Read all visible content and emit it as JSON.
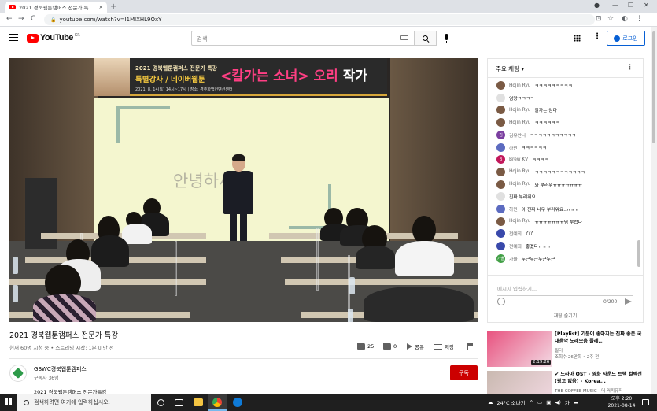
{
  "browser": {
    "tab_title": "2021 경북웹툰캠퍼스 전문가 특",
    "tab_close": "×",
    "new_tab": "+",
    "url": "youtube.com/watch?v=I1MlXHL9OxY",
    "window_controls": [
      "●",
      "—",
      "❐",
      "✕"
    ],
    "nav": [
      "←",
      "→",
      "C"
    ],
    "toolbar_icons": [
      "⊡",
      "☆",
      "◐",
      "⋮"
    ]
  },
  "youtube": {
    "logo_text": "YouTube",
    "logo_region": "KR",
    "search_placeholder": "검색",
    "login_label": "로그인"
  },
  "video": {
    "banner_line1": "2021 경북웹툰캠퍼스 전문가 특강",
    "banner_line2": "특별강사 / 네이버웹툰",
    "banner_title_part1": "<칼가는 소녀>",
    "banner_title_part2": " 오리",
    "banner_title_part3": "작가",
    "banner_info": "2021. 8. 14(토) 14시~17시 | 장소: 경주화백컨벤션센터",
    "screen_text": "안녕하세요.",
    "title": "2021 경북웹툰캠퍼스 전문가 특강",
    "meta": "현재 60명 시청 중 • 스트리밍 시작: 1분 미만 전",
    "likes": "25",
    "dislikes": "0",
    "share_label": "공유",
    "save_label": "저장"
  },
  "channel": {
    "name": "GBWC경북웹툰캠퍼스",
    "subscribers": "구독자 36명",
    "subscribe_label": "구독",
    "description": "2021 경북웹툰캠퍼스 전문가특강"
  },
  "chat": {
    "header": "주요 채팅 ▾",
    "messages": [
      {
        "author": "Hojin Ryu",
        "text": "ㅋㅋㅋㅋㅋㅋㅋㅋㅋ",
        "avatar": "",
        "color": "#7a5a44"
      },
      {
        "author": "",
        "text": "엄망ㅋㅋㅋㅋ",
        "avatar": "",
        "color": ""
      },
      {
        "author": "Hojin Ryu",
        "text": "칼가는 엄마",
        "avatar": "",
        "color": "#7a5a44"
      },
      {
        "author": "Hojin Ryu",
        "text": "ㅋㅋㅋㅋㅋㅋ",
        "avatar": "",
        "color": "#7a5a44"
      },
      {
        "author": "김유안나",
        "text": "ㅋㅋㅋㅋㅋㅋㅋㅋㅋㅋㅋ",
        "avatar": "김",
        "color": "#7b3fa0"
      },
      {
        "author": "하민",
        "text": "ㅋㅋㅋㅋㅋㅋ",
        "avatar": "",
        "color": "#5c6bc0"
      },
      {
        "author": "Brew KV",
        "text": "ㅋㅋㅋㅋ",
        "avatar": "B",
        "color": "#c2185b"
      },
      {
        "author": "Hojin Ryu",
        "text": "ㅋㅋㅋㅋㅋㅋㅋㅋㅋㅋㅋㅋ",
        "avatar": "",
        "color": "#7a5a44"
      },
      {
        "author": "Hojin Ryu",
        "text": "와 부러워ㅠㅠㅠㅠㅠㅠㅠ",
        "avatar": "",
        "color": "#7a5a44"
      },
      {
        "author": "",
        "text": "진짜 부러워요...",
        "avatar": "",
        "color": ""
      },
      {
        "author": "하민",
        "text": "아 진짜 너무 부러워요..ㅠㅠㅠ",
        "avatar": "",
        "color": "#5c6bc0"
      },
      {
        "author": "Hojin Ryu",
        "text": "ㅠㅠㅠㅠㅠㅠㅠ넘 부럽다",
        "avatar": "",
        "color": "#7a5a44"
      },
      {
        "author": "전예희",
        "text": "???",
        "avatar": "",
        "color": "#3949ab"
      },
      {
        "author": "전예희",
        "text": "좋겠다ㅠㅠㅠ",
        "avatar": "",
        "color": "#3949ab"
      },
      {
        "author": "가을",
        "text": "두근두근두근두근",
        "avatar": "가을",
        "color": "#43a047"
      }
    ],
    "input_placeholder": "메시지 입력하기...",
    "counter": "0/200",
    "hide_label": "채팅 숨기기"
  },
  "related": [
    {
      "title": "[Playlist] 기분이 좋아지는 진짜 좋은 국내음악 노래모음 플레...",
      "channel": "필터",
      "meta": "조회수 26만회 • 2주 전",
      "duration": "2:19:26",
      "thumb_color": "#e8527f"
    },
    {
      "title": "✔ 드라마 OST - 영화 사운드 트랙 컬렉션 (광고 없음) - Korea...",
      "channel": "THE COFFEE MUSIC - 더 커피뮤직",
      "meta": "",
      "duration": "",
      "thumb_color": "#c9b9b0"
    }
  ],
  "taskbar": {
    "search_placeholder": "검색하려면 여기에 입력하십시오.",
    "weather": "24°C 소나기",
    "time": "오후 2:20",
    "date": "2021-08-14"
  }
}
